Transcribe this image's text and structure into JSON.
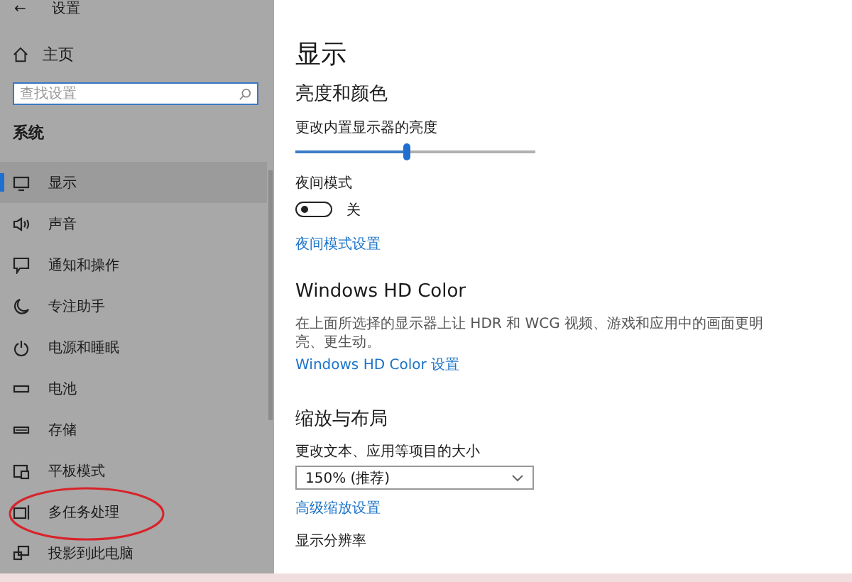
{
  "window": {
    "title": "设置",
    "back": "←"
  },
  "sidebar": {
    "home": "主页",
    "search": {
      "placeholder": "查找设置"
    },
    "section": "系统",
    "items": [
      {
        "label": "显示",
        "selected": true
      },
      {
        "label": "声音",
        "selected": false
      },
      {
        "label": "通知和操作",
        "selected": false
      },
      {
        "label": "专注助手",
        "selected": false
      },
      {
        "label": "电源和睡眠",
        "selected": false
      },
      {
        "label": "电池",
        "selected": false
      },
      {
        "label": "存储",
        "selected": false
      },
      {
        "label": "平板模式",
        "selected": false
      },
      {
        "label": "多任务处理",
        "selected": false
      },
      {
        "label": "投影到此电脑",
        "selected": false
      }
    ]
  },
  "content": {
    "title": "显示",
    "brightness": {
      "heading": "亮度和颜色",
      "label": "更改内置显示器的亮度",
      "level": 0.46
    },
    "night_mode": {
      "label": "夜间模式",
      "on": false,
      "state_text": "关",
      "link": "夜间模式设置"
    },
    "hd_color": {
      "heading": "Windows HD Color",
      "description": "在上面所选择的显示器上让 HDR 和 WCG 视频、游戏和应用中的画面更明亮、更生动。",
      "link": "Windows HD Color 设置"
    },
    "scale": {
      "heading": "缩放与布局",
      "label": "更改文本、应用等项目的大小",
      "value": "150% (推荐)",
      "link": "高级缩放设置"
    },
    "resolution": {
      "label": "显示分辨率"
    }
  }
}
